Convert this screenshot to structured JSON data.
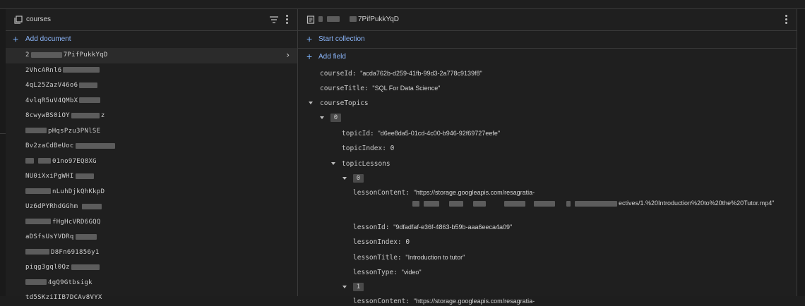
{
  "left_panel": {
    "title": "courses",
    "add_document_label": "Add document",
    "documents": [
      {
        "id": "2",
        "tail": "7PifPukkYqD",
        "selected": true
      },
      {
        "id": "2VhcARnl6",
        "tail": ""
      },
      {
        "id": "4qL25ZazV46o6",
        "tail": ""
      },
      {
        "id": "4vlqR5uV4QMbX",
        "tail": ""
      },
      {
        "id": "8cwywBS0iOY",
        "tail": "z"
      },
      {
        "id": "",
        "tail": "pHqsPzu3PNlSE"
      },
      {
        "id": "Bv2zaCdBeUoc",
        "tail": ""
      },
      {
        "id": "",
        "tail": "01no97EQ8XG"
      },
      {
        "id": "NU0iXxiPgWHI",
        "tail": ""
      },
      {
        "id": "",
        "tail": "nLuhDjkQhKkpD"
      },
      {
        "id": "Uz6dPYRhdGGhm",
        "tail": ""
      },
      {
        "id": "",
        "tail": "fHgHcVRD6GQQ"
      },
      {
        "id": "aDSfsUsYVDRq",
        "tail": ""
      },
      {
        "id": "",
        "tail": "D8Fn691856y1"
      },
      {
        "id": "piqg3gql0Qz",
        "tail": ""
      },
      {
        "id": "",
        "tail": "4gQ9Gtbsigk"
      },
      {
        "id": "td5SKzi",
        "tail": "IIB7DCAv8VYX"
      }
    ]
  },
  "right_panel": {
    "title_tail": "7PifPukkYqD",
    "start_collection_label": "Start collection",
    "add_field_label": "Add field",
    "course_id_key": "courseId:",
    "course_id_val": "\"acda762b-d259-41fb-99d3-2a778c9139f8\"",
    "course_title_key": "courseTitle:",
    "course_title_val": "\"SQL For Data Science\"",
    "course_topics_key": "courseTopics",
    "topic_index_badge": "0",
    "topic_id_key": "topicId:",
    "topic_id_val": "\"d6ee8da5-01cd-4c00-b946-92f69727eefe\"",
    "topic_index_key": "topicIndex:",
    "topic_index_val": "0",
    "topic_lessons_key": "topicLessons",
    "lesson0_badge": "0",
    "lesson_content_key": "lessonContent:",
    "lesson_content_val_line1": "\"https://storage.googleapis.com/resagratia-",
    "lesson_content_val_line2": "ectives/1.%20Introduction%20to%20the%20Tutor.mp4\"",
    "lesson_id_key": "lessonId:",
    "lesson_id_val": "\"9dfadfaf-e36f-4863-b59b-aaa6eeca4a09\"",
    "lesson_index_key": "lessonIndex:",
    "lesson_index_val": "0",
    "lesson_title_key": "lessonTitle:",
    "lesson_title_val": "\"Introduction to tutor\"",
    "lesson_type_key": "lessonType:",
    "lesson_type_val": "\"video\"",
    "lesson1_badge": "1",
    "lesson1_content_key": "lessonContent:",
    "lesson1_content_val": "\"https://storage.googleapis.com/resagratia-"
  },
  "icons": {
    "collection": "collection-icon",
    "document": "document-icon",
    "filter": "filter-icon",
    "more": "more-vert-icon",
    "plus": "plus-icon",
    "chevron": "chevron-right-icon",
    "expand": "expand-arrow-icon"
  }
}
